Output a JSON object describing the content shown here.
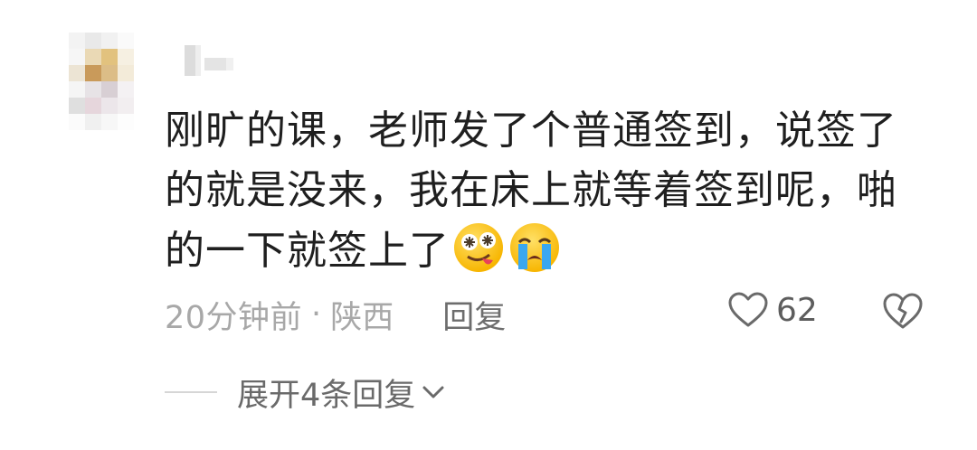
{
  "comment": {
    "text": "刚旷的课，老师发了个普通签到，说签了的就是没来，我在床上就等着签到呢，啪的一下就签上了",
    "emojis": [
      "drooling-dizzy-face-emoji",
      "loudly-crying-face-emoji"
    ],
    "time": "20分钟前",
    "separator": "·",
    "location": "陕西",
    "reply_label": "回复",
    "like_count": "62",
    "icons": {
      "like": "heart-outline-icon",
      "dislike": "broken-heart-icon",
      "expand": "chevron-down-icon"
    }
  },
  "expand": {
    "label": "展开4条回复"
  },
  "colors": {
    "text": "#1f1f1f",
    "meta": "#a8a8a8",
    "secondary": "#6d6d6d",
    "divider": "#d6d6d6"
  }
}
